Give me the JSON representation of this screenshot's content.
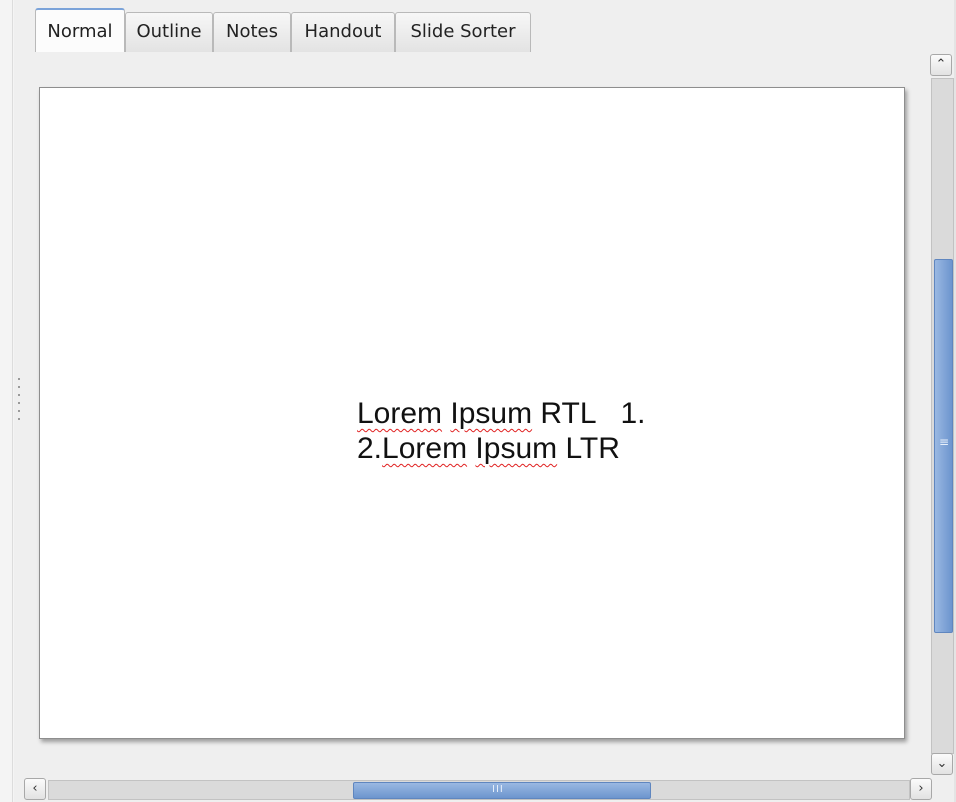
{
  "tabs": [
    {
      "label": "Normal",
      "active": true
    },
    {
      "label": "Outline",
      "active": false
    },
    {
      "label": "Notes",
      "active": false
    },
    {
      "label": "Handout",
      "active": false
    },
    {
      "label": "Slide Sorter",
      "active": false
    }
  ],
  "slide": {
    "line1": {
      "word1": "Lorem",
      "word2": "Ipsum",
      "rest": " RTL   1."
    },
    "line2": {
      "prefix": "2.",
      "word1": "Lorem",
      "word2": "Ipsum",
      "rest": " LTR"
    }
  },
  "scrollbars": {
    "up_glyph": "⌃",
    "down_glyph": "⌄",
    "left_glyph": "‹",
    "right_glyph": "›",
    "v_grip": "≡",
    "h_grip": "III"
  },
  "colors": {
    "accent": "#6c95ce",
    "spellcheck": "#e02020"
  }
}
